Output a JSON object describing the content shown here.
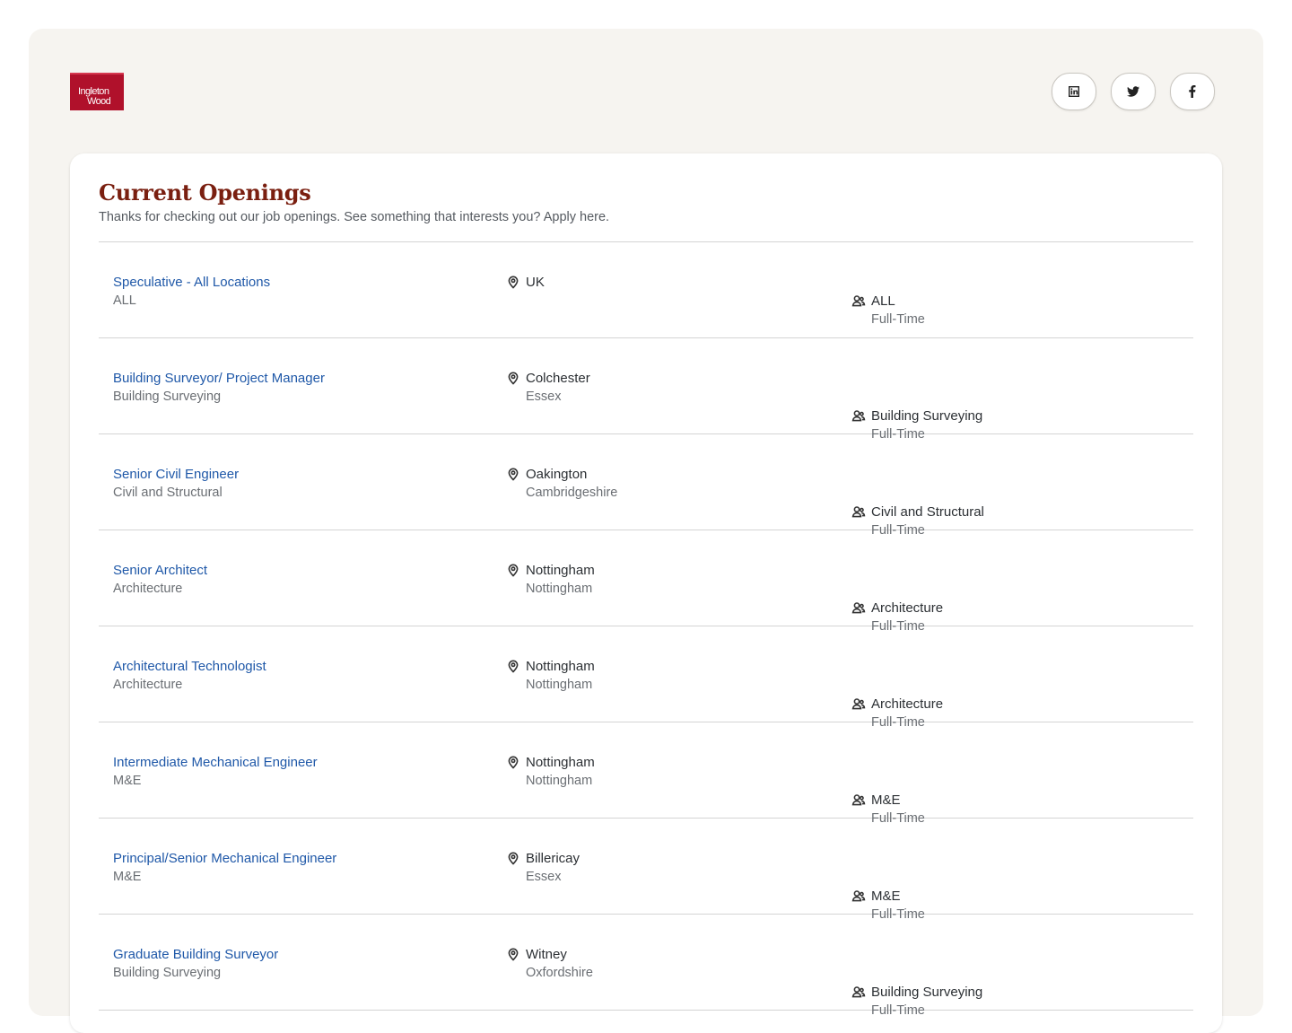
{
  "brand": {
    "logo_line1": "Ingleton",
    "logo_line2": "Wood",
    "color": "#b0112b"
  },
  "socials": [
    {
      "name": "linkedin-icon",
      "label": "LinkedIn"
    },
    {
      "name": "twitter-icon",
      "label": "Twitter"
    },
    {
      "name": "facebook-icon",
      "label": "Facebook"
    }
  ],
  "page": {
    "title": "Current Openings",
    "subtitle": "Thanks for checking out our job openings. See something that interests you? Apply here.",
    "title_color": "#7a1f10",
    "link_color": "#1f58a8"
  },
  "jobs": [
    {
      "title": "Speculative - All Locations",
      "department": "ALL",
      "location": "UK",
      "region": "",
      "team": "ALL",
      "type": "Full-Time"
    },
    {
      "title": "Building Surveyor/ Project Manager",
      "department": "Building Surveying",
      "location": "Colchester",
      "region": "Essex",
      "team": "Building Surveying",
      "type": "Full-Time"
    },
    {
      "title": "Senior Civil Engineer",
      "department": "Civil and Structural",
      "location": "Oakington",
      "region": "Cambridgeshire",
      "team": "Civil and Structural",
      "type": "Full-Time"
    },
    {
      "title": "Senior Architect",
      "department": "Architecture",
      "location": "Nottingham",
      "region": "Nottingham",
      "team": "Architecture",
      "type": "Full-Time"
    },
    {
      "title": "Architectural Technologist",
      "department": "Architecture",
      "location": "Nottingham",
      "region": "Nottingham",
      "team": "Architecture",
      "type": "Full-Time"
    },
    {
      "title": "Intermediate Mechanical Engineer",
      "department": "M&E",
      "location": "Nottingham",
      "region": "Nottingham",
      "team": "M&E",
      "type": "Full-Time"
    },
    {
      "title": "Principal/Senior Mechanical Engineer",
      "department": "M&E",
      "location": "Billericay",
      "region": "Essex",
      "team": "M&E",
      "type": "Full-Time"
    },
    {
      "title": "Graduate Building Surveyor",
      "department": "Building Surveying",
      "location": "Witney",
      "region": "Oxfordshire",
      "team": "Building Surveying",
      "type": "Full-Time"
    }
  ]
}
